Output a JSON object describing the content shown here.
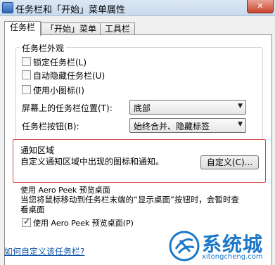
{
  "window": {
    "title": "任务栏和「开始」菜单属性",
    "close_glyph": "✕"
  },
  "tabs": [
    {
      "label": "任务栏",
      "active": true
    },
    {
      "label": "「开始」菜单",
      "active": false
    },
    {
      "label": "工具栏",
      "active": false
    }
  ],
  "appearance": {
    "title": "任务栏外观",
    "checkboxes": [
      {
        "label": "锁定任务栏(L)",
        "checked": false
      },
      {
        "label": "自动隐藏任务栏(U)",
        "checked": false
      },
      {
        "label": "使用小图标(I)",
        "checked": false
      }
    ],
    "location_label": "屏幕上的任务栏位置(T):",
    "location_value": "底部",
    "buttons_label": "任务栏按钮(B):",
    "buttons_value": "始终合并、隐藏标签"
  },
  "notification": {
    "title": "通知区域",
    "description": "自定义通知区域中出现的图标和通知。",
    "customize_button": "自定义(C)..."
  },
  "aero_peek": {
    "title": "使用 Aero Peek 预览桌面",
    "description": "当您将鼠标移动到任务栏末端的“显示桌面”按钮时，会暂时查看桌面",
    "checkbox_label": "使用 Aero Peek 预览桌面(P)",
    "checked": true
  },
  "help_link": "如何自定义该任务栏?",
  "watermark": {
    "text": "系统城",
    "url": "xitongcheng.com"
  },
  "colors": {
    "highlight_border": "#d24a4a",
    "link": "#0b53a7",
    "watermark": "#1b77c7"
  }
}
